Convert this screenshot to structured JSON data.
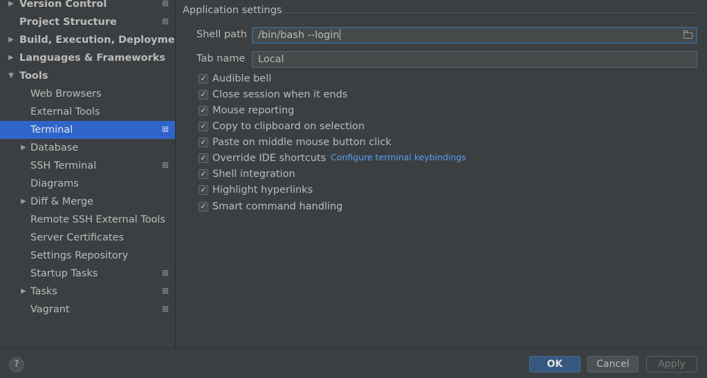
{
  "sidebar": {
    "items": [
      {
        "label": "Version Control",
        "expanded": false,
        "bold": true,
        "project_icon": true
      },
      {
        "label": "Project Structure",
        "bold": true,
        "project_icon": true
      },
      {
        "label": "Build, Execution, Deployment",
        "expanded": false,
        "bold": true
      },
      {
        "label": "Languages & Frameworks",
        "expanded": false,
        "bold": true
      },
      {
        "label": "Tools",
        "expanded": true,
        "bold": true
      },
      {
        "label": "Web Browsers"
      },
      {
        "label": "External Tools"
      },
      {
        "label": "Terminal",
        "selected": true,
        "project_icon": true
      },
      {
        "label": "Database",
        "expanded": false
      },
      {
        "label": "SSH Terminal",
        "project_icon": true
      },
      {
        "label": "Diagrams"
      },
      {
        "label": "Diff & Merge",
        "expanded": false
      },
      {
        "label": "Remote SSH External Tools"
      },
      {
        "label": "Server Certificates"
      },
      {
        "label": "Settings Repository"
      },
      {
        "label": "Startup Tasks",
        "project_icon": true
      },
      {
        "label": "Tasks",
        "expanded": false,
        "project_icon": true
      },
      {
        "label": "Vagrant",
        "project_icon": true
      }
    ]
  },
  "settings": {
    "group_title": "Application settings",
    "shell_path_label": "Shell path",
    "shell_path_value": "/bin/bash --login",
    "tab_name_label": "Tab name",
    "tab_name_value": "Local",
    "checkboxes": [
      {
        "label": "Audible bell",
        "checked": true
      },
      {
        "label": "Close session when it ends",
        "checked": true
      },
      {
        "label": "Mouse reporting",
        "checked": true
      },
      {
        "label": "Copy to clipboard on selection",
        "checked": true
      },
      {
        "label": "Paste on middle mouse button click",
        "checked": true
      },
      {
        "label": "Override IDE shortcuts",
        "checked": true
      },
      {
        "label": "Shell integration",
        "checked": true
      },
      {
        "label": "Highlight hyperlinks",
        "checked": true
      },
      {
        "label": "Smart command handling",
        "checked": true
      }
    ],
    "keybindings_link": "Configure terminal keybindings"
  },
  "buttons": {
    "help": "?",
    "ok": "OK",
    "cancel": "Cancel",
    "apply": "Apply"
  },
  "colors": {
    "background": "#3c3f41",
    "selection": "#2f65ca",
    "link": "#589df6",
    "ok_button": "#365880"
  },
  "icons": {
    "collapsed_arrow": "▶",
    "expanded_arrow": "▼",
    "checkmark": "✓",
    "project_level": "project-settings-icon",
    "browse": "folder-icon"
  }
}
